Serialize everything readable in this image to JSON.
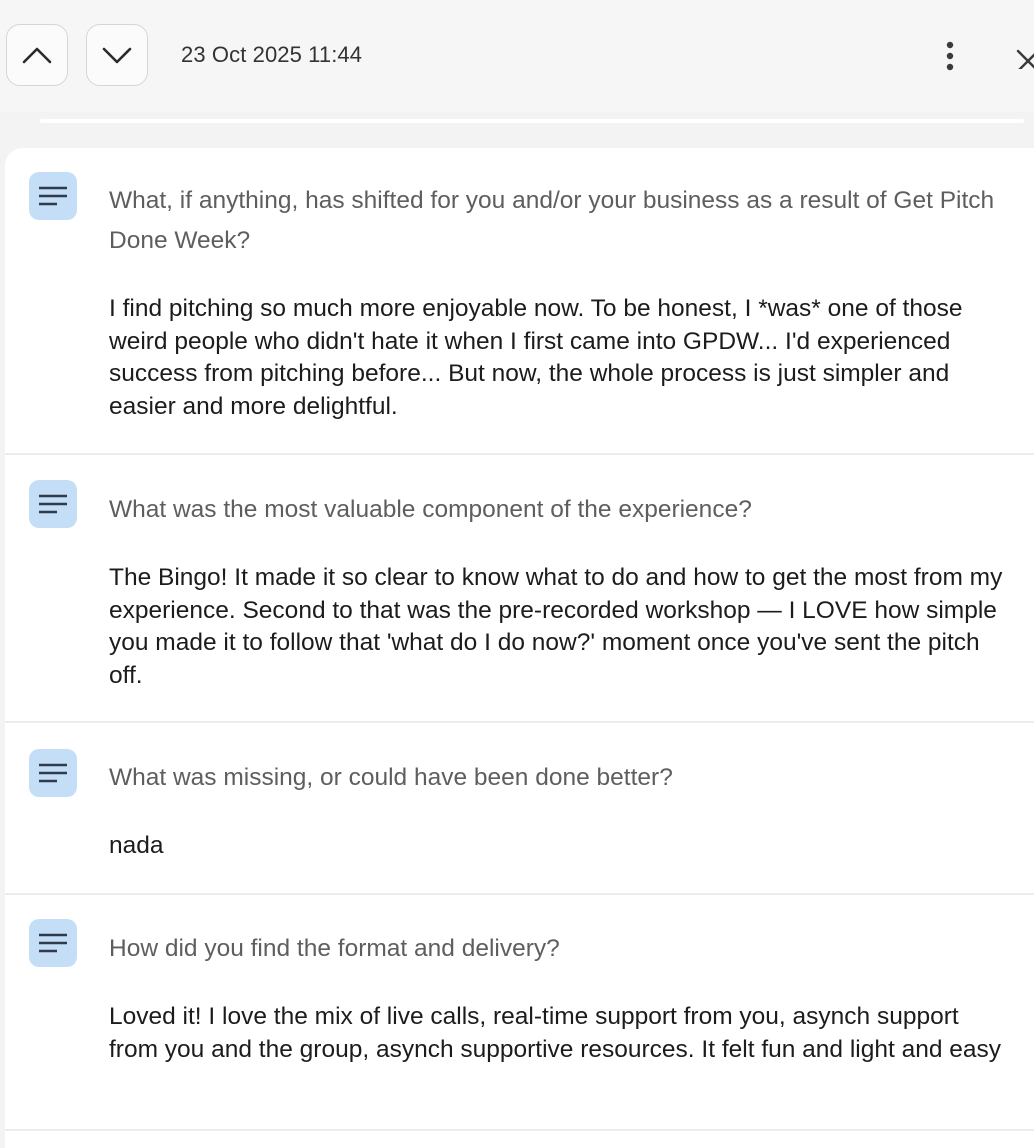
{
  "header": {
    "timestamp": "23 Oct 2025 11:44",
    "prev_icon": "chevron-up-icon",
    "next_icon": "chevron-down-icon",
    "more_icon": "more-vertical-icon",
    "close_icon": "close-icon"
  },
  "accent_colors": {
    "icon_background": "#c5def8",
    "icon_foreground": "#2f3a4a"
  },
  "responses": [
    {
      "icon": "text-lines-icon",
      "question": "What, if anything, has shifted for you and/or your business as a result of Get Pitch Done Week?",
      "answer": "I find pitching so much more enjoyable now. To be honest, I *was* one of those weird people who didn't hate it when I first came into GPDW... I'd experienced success from pitching before... But now, the whole process is just simpler and easier and more delightful."
    },
    {
      "icon": "text-lines-icon",
      "question": "What was the most valuable component of the experience?",
      "answer": "The Bingo! It made it so clear to know what to do and how to get the most from my experience. Second to that was the pre-recorded workshop — I LOVE how simple you made it to follow that 'what do I do now?' moment once you've sent the pitch off."
    },
    {
      "icon": "text-lines-icon",
      "question": "What was missing, or could have been done better?",
      "answer": "nada"
    },
    {
      "icon": "text-lines-icon",
      "question": "How did you find the format and delivery?",
      "answer": "Loved it! I love the mix of live calls, real-time support from you, asynch support from you and the group, asynch supportive resources. It felt fun and light and easy"
    }
  ]
}
